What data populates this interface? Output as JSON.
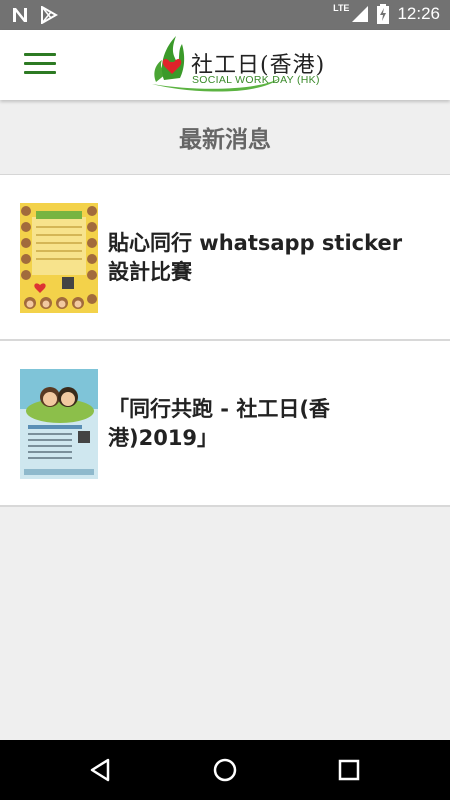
{
  "status_bar": {
    "network_label": "LTE",
    "time": "12:26"
  },
  "app_bar": {
    "menu_icon": "hamburger-icon",
    "logo": {
      "title": "社工日(香港)",
      "subtitle": "SOCIAL WORK DAY (HK)"
    }
  },
  "section": {
    "title": "最新消息"
  },
  "news": [
    {
      "title": "貼心同行 whatsapp sticker 設計比賽",
      "thumbnail_desc": "sticker-contest-poster"
    },
    {
      "title": "「同行共跑 - 社工日(香港)2019」",
      "thumbnail_desc": "run-event-poster"
    }
  ],
  "nav_bar": {
    "back_icon": "back-triangle-icon",
    "home_icon": "home-circle-icon",
    "recents_icon": "recents-square-icon"
  },
  "colors": {
    "accent": "#2d7a23",
    "status_bar": "#727272",
    "background": "#efefef"
  }
}
